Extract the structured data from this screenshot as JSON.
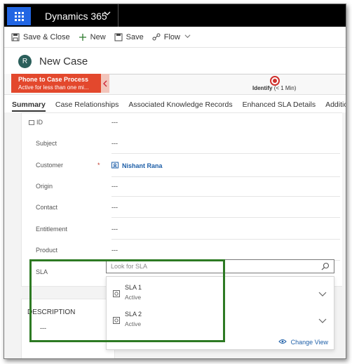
{
  "app": {
    "title": "Dynamics 365"
  },
  "toolbar": {
    "save_close": "Save & Close",
    "new": "New",
    "save": "Save",
    "flow": "Flow"
  },
  "record": {
    "avatar_initial": "R",
    "title": "New Case"
  },
  "process": {
    "name": "Phone to Case Process",
    "status": "Active for less than one mi...",
    "stage_name": "Identify",
    "stage_duration": "(< 1 Min)"
  },
  "tabs": [
    "Summary",
    "Case Relationships",
    "Associated Knowledge Records",
    "Enhanced SLA Details",
    "Additional Details"
  ],
  "form": {
    "id_label": "ID",
    "id_value": "---",
    "fields": [
      {
        "label": "Subject",
        "value": "---"
      },
      {
        "label": "Customer",
        "value": "Nishant Rana",
        "required": "*"
      },
      {
        "label": "Origin",
        "value": "---"
      },
      {
        "label": "Contact",
        "value": "---"
      },
      {
        "label": "Entitlement",
        "value": "---"
      },
      {
        "label": "Product",
        "value": "---"
      },
      {
        "label": "SLA"
      }
    ],
    "sla_placeholder": "Look for SLA"
  },
  "sla_options": [
    {
      "name": "SLA 1",
      "status": "Active"
    },
    {
      "name": "SLA 2",
      "status": "Active"
    }
  ],
  "change_view": "Change View",
  "description": {
    "title": "DESCRIPTION",
    "value": "---"
  },
  "colors": {
    "nav": "#000000",
    "waffle": "#2266e3",
    "process": "#e3482d",
    "link": "#1e5fa8",
    "highlight": "#2d7a23"
  }
}
